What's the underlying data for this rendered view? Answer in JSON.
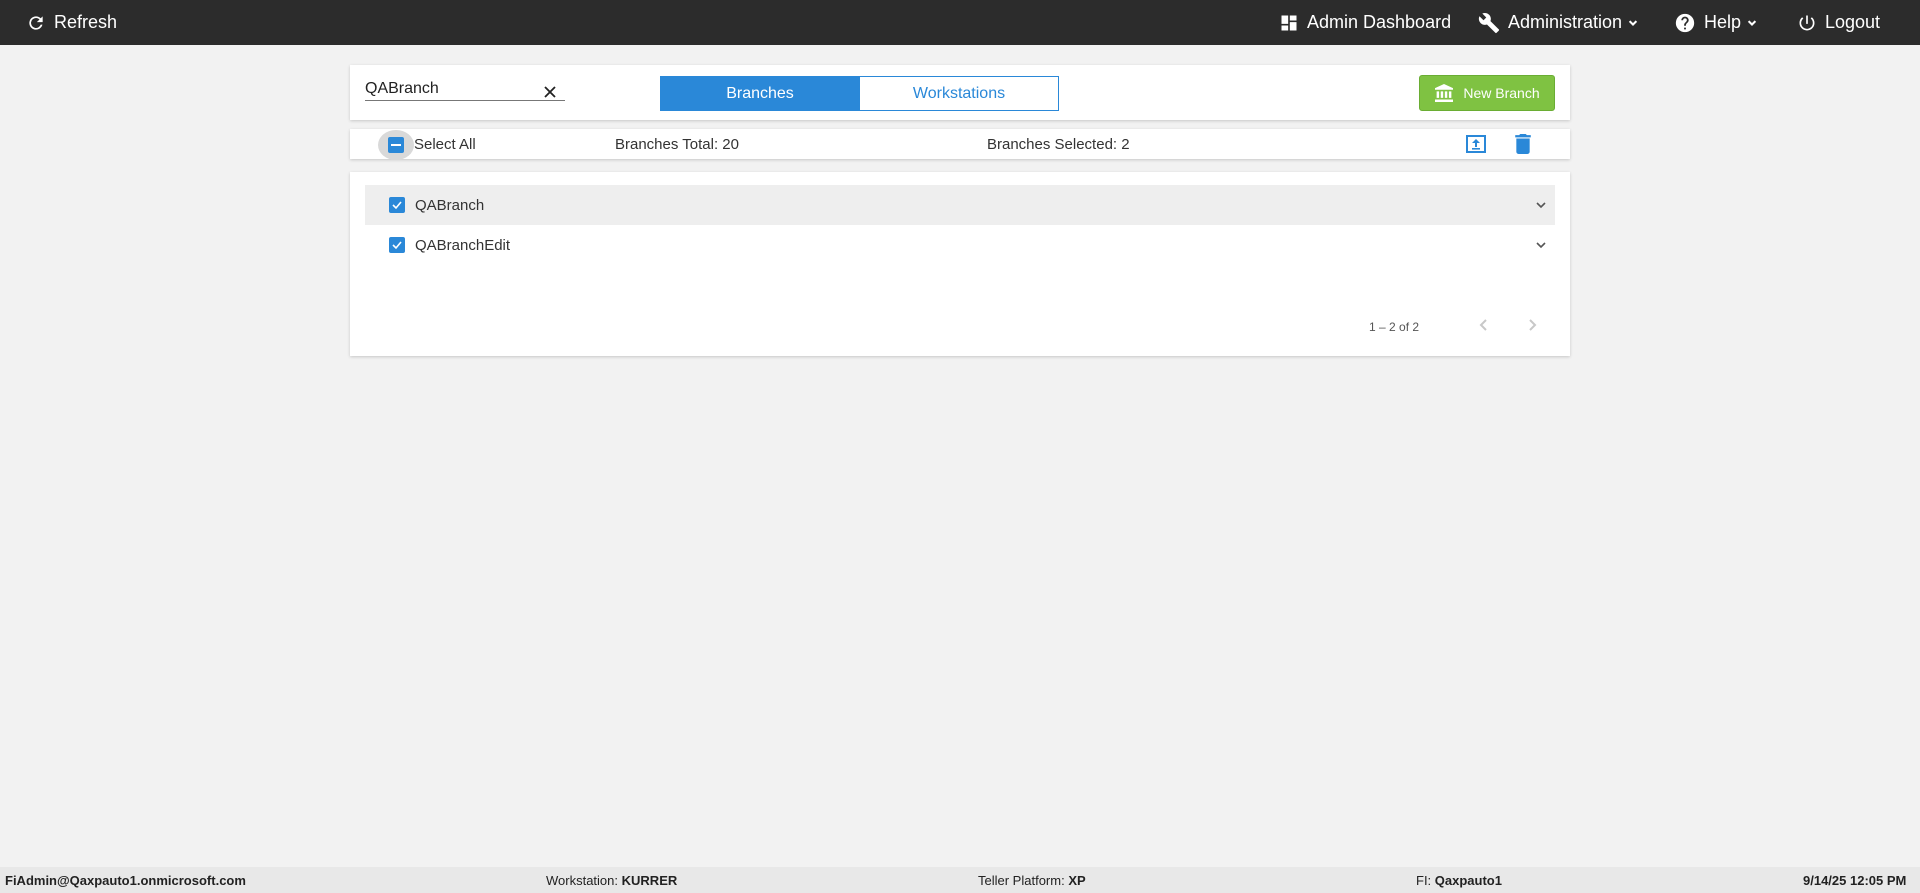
{
  "topbar": {
    "refresh_label": "Refresh",
    "admin_dashboard_label": "Admin Dashboard",
    "administration_label": "Administration",
    "help_label": "Help",
    "logout_label": "Logout",
    "background_color": "#2c2c2c"
  },
  "search": {
    "value": "QABranch",
    "clear_icon": "close-icon"
  },
  "tabs": [
    {
      "label": "Branches",
      "active": true
    },
    {
      "label": "Workstations",
      "active": false
    }
  ],
  "new_branch": {
    "label": "New Branch",
    "icon": "bank-icon",
    "color": "#7fc242"
  },
  "summary": {
    "select_all_label": "Select All",
    "select_all_state": "indeterminate",
    "branches_total": "Branches Total: 20",
    "branches_selected": "Branches Selected: 2",
    "actions": [
      "export-icon",
      "trash-icon"
    ]
  },
  "branches": [
    {
      "name": "QABranch",
      "checked": true
    },
    {
      "name": "QABranchEdit",
      "checked": true
    }
  ],
  "pagination": {
    "range": "1 – 2 of 2"
  },
  "footer": {
    "user": "FiAdmin@Qaxpauto1.onmicrosoft.com",
    "workstation_label": "Workstation:",
    "workstation_value": "KURRER",
    "teller_platform_label": "Teller Platform:",
    "teller_platform_value": "XP",
    "fi_label": "FI:",
    "fi_value": "Qaxpauto1",
    "datetime": "9/14/25 12:05 PM"
  },
  "colors": {
    "accent": "#2a88d8",
    "page_background": "#f2f2f2"
  }
}
